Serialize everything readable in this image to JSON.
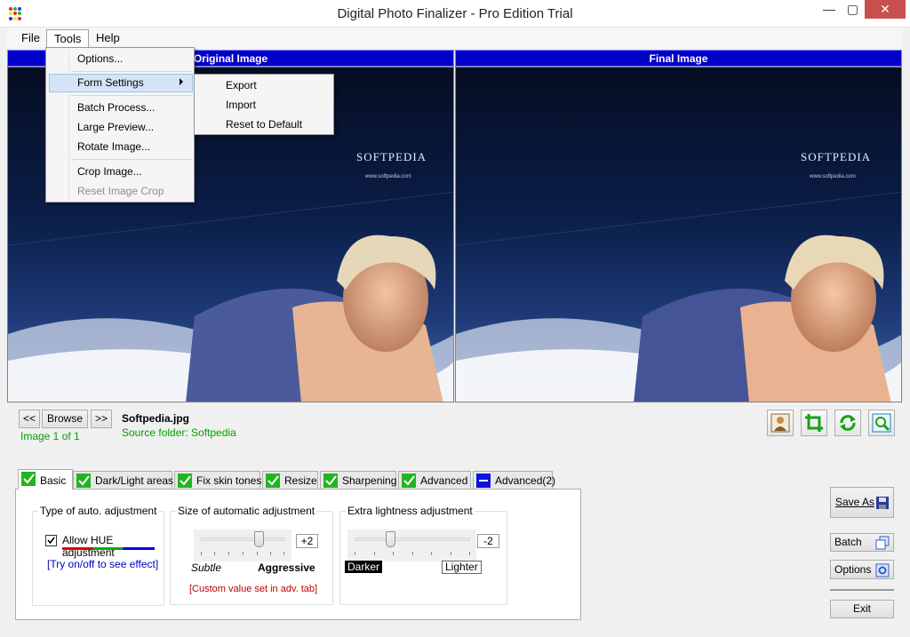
{
  "window": {
    "title": "Digital Photo Finalizer - Pro Edition Trial",
    "min_glyph": "—",
    "max_glyph": "▢",
    "close_glyph": "✕"
  },
  "menubar": {
    "file": "File",
    "tools": "Tools",
    "help": "Help"
  },
  "tools_menu": {
    "items": [
      "Options...",
      "Form Settings",
      "Batch Process...",
      "Large Preview...",
      "Rotate Image...",
      "Crop Image...",
      "Reset Image Crop"
    ],
    "disabled": [
      "Reset Image Crop"
    ],
    "highlighted": "Form Settings"
  },
  "form_settings_submenu": {
    "items": [
      "Export",
      "Import",
      "Reset to Default"
    ]
  },
  "panels": {
    "original_title": "Original Image",
    "final_title": "Final Image",
    "logo_text": "SOFTPEDIA",
    "logo_url": "www.softpedia.com"
  },
  "navigation": {
    "prev": "<<",
    "browse": "Browse",
    "next": ">>",
    "image_counter": "Image 1 of 1",
    "filename": "Softpedia.jpg",
    "source_folder": "Source folder: Softpedia"
  },
  "toolbar_icons": [
    "portrait-icon",
    "crop-icon",
    "rotate-icon",
    "zoom-icon"
  ],
  "tabs": [
    {
      "label": "Basic",
      "state": "checked",
      "selected": true
    },
    {
      "label": "Dark/Light areas",
      "state": "checked",
      "selected": false
    },
    {
      "label": "Fix skin tones",
      "state": "checked",
      "selected": false
    },
    {
      "label": "Resize",
      "state": "checked",
      "selected": false
    },
    {
      "label": "Sharpening",
      "state": "checked",
      "selected": false
    },
    {
      "label": "Advanced",
      "state": "checked",
      "selected": false
    },
    {
      "label": "Advanced(2)",
      "state": "minus",
      "selected": false
    }
  ],
  "basic": {
    "auto_type": {
      "group_title": "Type of auto. adjustment",
      "checkbox_label": "Allow HUE adjustment",
      "checked": true,
      "hint": "[Try on/off to see effect]"
    },
    "auto_size": {
      "group_title": "Size of automatic adjustment",
      "value": "+2",
      "min_label": "Subtle",
      "max_label": "Aggressive",
      "note": "[Custom value set in adv. tab]",
      "level": 0.67
    },
    "lightness": {
      "group_title": "Extra lightness adjustment",
      "value": "-2",
      "min_label": "Darker",
      "max_label": "Lighter",
      "level": 0.33
    }
  },
  "side_buttons": {
    "save_as": "Save As",
    "batch": "Batch",
    "options": "Options",
    "exit": "Exit"
  },
  "colors": {
    "header_blue": "#0000c8",
    "green_text": "#00a000",
    "note_red": "#c00000",
    "hint_blue": "#0000c0",
    "close_red": "#c7504e"
  }
}
